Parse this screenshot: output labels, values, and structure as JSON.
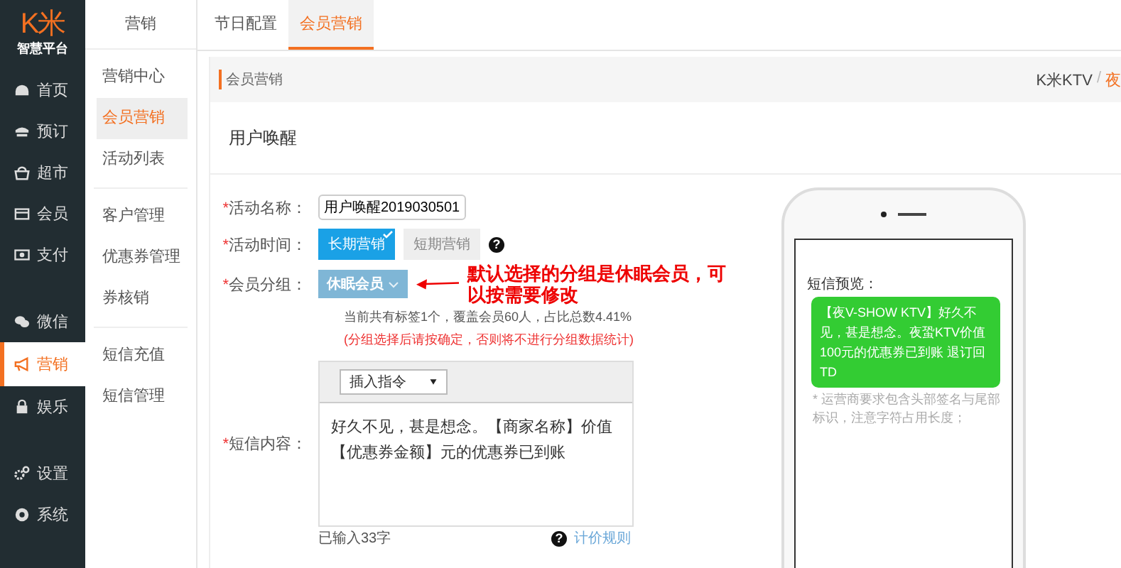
{
  "logo": {
    "mark": "K米",
    "subtitle": "智慧平台"
  },
  "sidebar": {
    "groups": [
      {
        "items": [
          {
            "label": "首页",
            "selected": false
          },
          {
            "label": "预订",
            "selected": false
          },
          {
            "label": "超市",
            "selected": false
          },
          {
            "label": "会员",
            "selected": false
          },
          {
            "label": "支付",
            "selected": false
          }
        ]
      },
      {
        "items": [
          {
            "label": "微信",
            "selected": false
          },
          {
            "label": "营销",
            "selected": true
          },
          {
            "label": "娱乐",
            "selected": false
          }
        ]
      },
      {
        "items": [
          {
            "label": "设置",
            "selected": false
          },
          {
            "label": "系统",
            "selected": false
          }
        ]
      }
    ]
  },
  "subnav": {
    "title": "营销",
    "groups": [
      {
        "items": [
          {
            "label": "营销中心",
            "selected": false
          },
          {
            "label": "会员营销",
            "selected": true
          },
          {
            "label": "活动列表",
            "selected": false
          }
        ]
      },
      {
        "items": [
          {
            "label": "客户管理",
            "selected": false
          },
          {
            "label": "优惠券管理",
            "selected": false
          },
          {
            "label": "券核销",
            "selected": false
          }
        ]
      },
      {
        "items": [
          {
            "label": "短信充值",
            "selected": false
          },
          {
            "label": "短信管理",
            "selected": false
          }
        ]
      }
    ]
  },
  "tabs": [
    {
      "label": "节日配置",
      "selected": false
    },
    {
      "label": "会员营销",
      "selected": true
    }
  ],
  "breadcrumb": {
    "title": "会员营销",
    "path": [
      {
        "label": "K米KTV",
        "current": false
      },
      {
        "label": "夜",
        "current": true
      }
    ],
    "separator": "/"
  },
  "section_title": "用户唤醒",
  "form": {
    "required_mark": "*",
    "name": {
      "label": "活动名称：",
      "value": "用户唤醒2019030501"
    },
    "time": {
      "label": "活动时间：",
      "options": [
        {
          "label": "长期营销",
          "selected": true
        },
        {
          "label": "短期营销",
          "selected": false
        }
      ],
      "help": "?"
    },
    "group": {
      "label": "会员分组：",
      "value": "休眠会员",
      "annotation": "默认选择的分组是休眠会员，可以按需要修改",
      "info": "当前共有标签1个，覆盖会员60人，占比总数4.41%",
      "warning": "(分组选择后请按确定，否则将不进行分组数据统计)"
    },
    "sms": {
      "label": "短信内容：",
      "insert": "插入指令",
      "content": "好久不见，甚是想念。【商家名称】价值【优惠券金额】元的优惠券已到账",
      "count": "已输入33字",
      "help": "?",
      "link": "计价规则"
    }
  },
  "preview": {
    "title": "短信预览：",
    "message": "【夜V-SHOW KTV】好久不见，甚是想念。夜蛩KTV价值100元的优惠券已到账 退订回TD",
    "note": "* 运营商要求包含头部签名与尾部标识，注意字符占用长度；"
  }
}
